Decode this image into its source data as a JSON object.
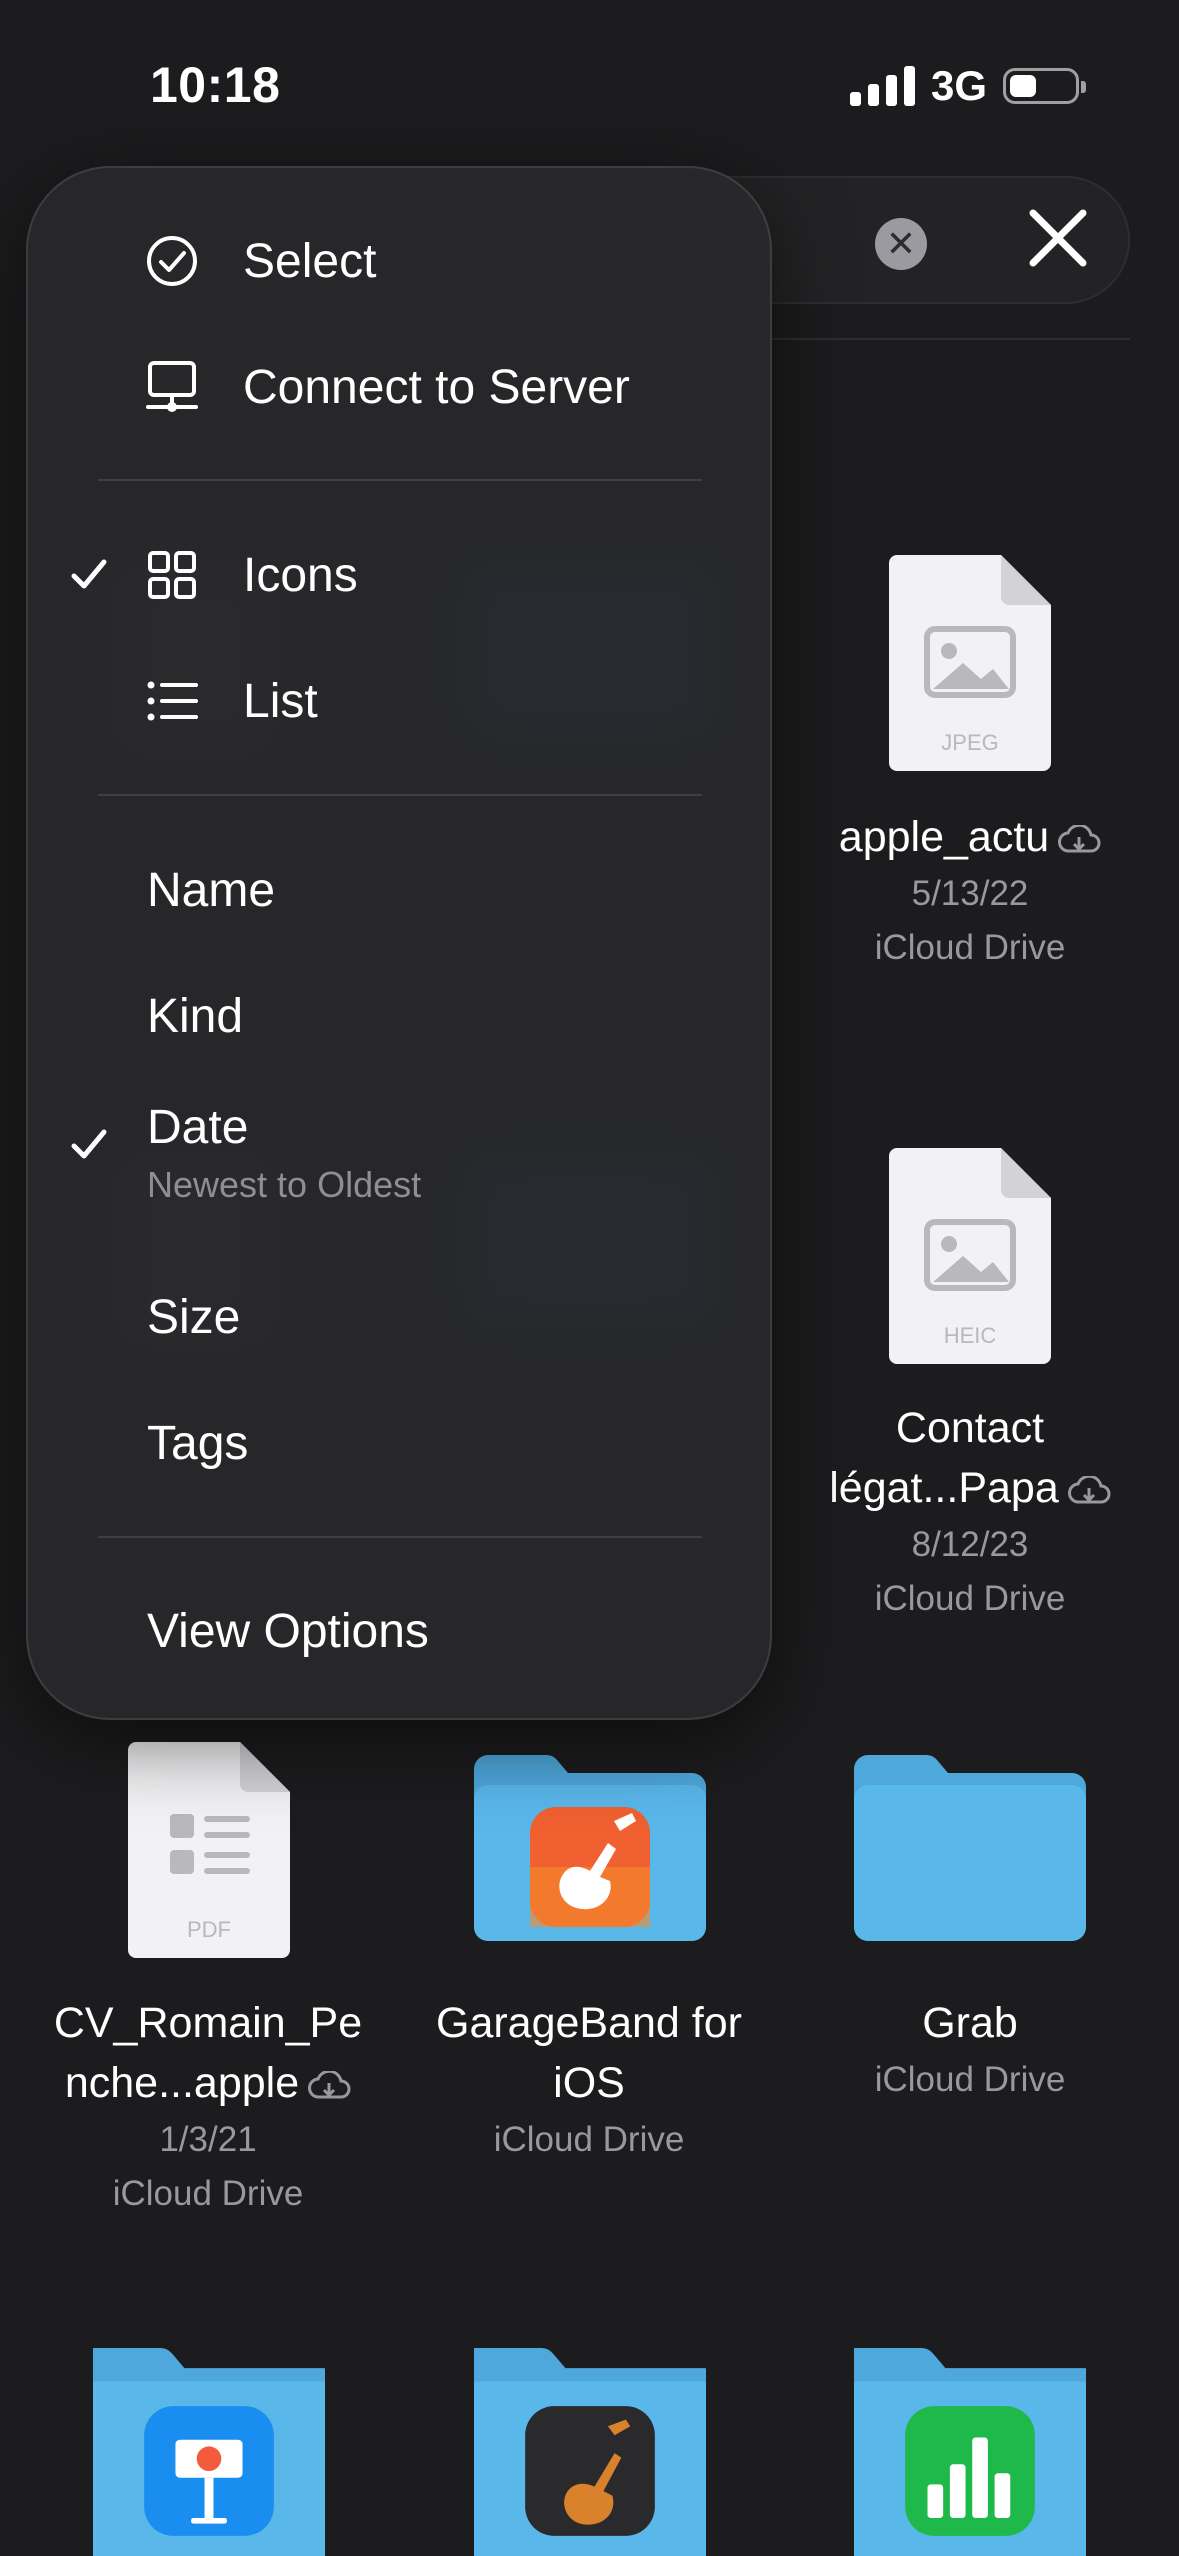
{
  "status_bar": {
    "time": "10:18",
    "network": "3G"
  },
  "menu": {
    "actions": [
      {
        "label": "Select",
        "icon": "checkmark-circle-icon"
      },
      {
        "label": "Connect to Server",
        "icon": "server-icon"
      }
    ],
    "view_modes": [
      {
        "label": "Icons",
        "icon": "grid-icon",
        "checked": true
      },
      {
        "label": "List",
        "icon": "list-icon",
        "checked": false
      }
    ],
    "sort": [
      {
        "label": "Name"
      },
      {
        "label": "Kind"
      },
      {
        "label": "Date",
        "subtitle": "Newest to Oldest",
        "checked": true
      },
      {
        "label": "Size"
      },
      {
        "label": "Tags"
      }
    ],
    "view_options": "View Options"
  },
  "files": [
    {
      "name": "apple_actu",
      "date": "5/13/22",
      "location": "iCloud Drive",
      "type": "JPEG"
    },
    {
      "name_line1": "Contact",
      "name_line2": "légat...Papa",
      "date": "8/12/23",
      "location": "iCloud Drive",
      "type": "HEIC"
    },
    {
      "name_line1": "CV_Romain_Pe",
      "name_line2": "nche...apple",
      "date": "1/3/21",
      "location": "iCloud Drive",
      "type": "PDF"
    },
    {
      "name_line1": "GarageBand for",
      "name_line2": "iOS",
      "location": "iCloud Drive"
    },
    {
      "name": "Grab",
      "location": "iCloud Drive"
    }
  ],
  "colors": {
    "folder": "#5ab7ea",
    "background": "#1c1c1e",
    "accent": "#ffffff"
  }
}
